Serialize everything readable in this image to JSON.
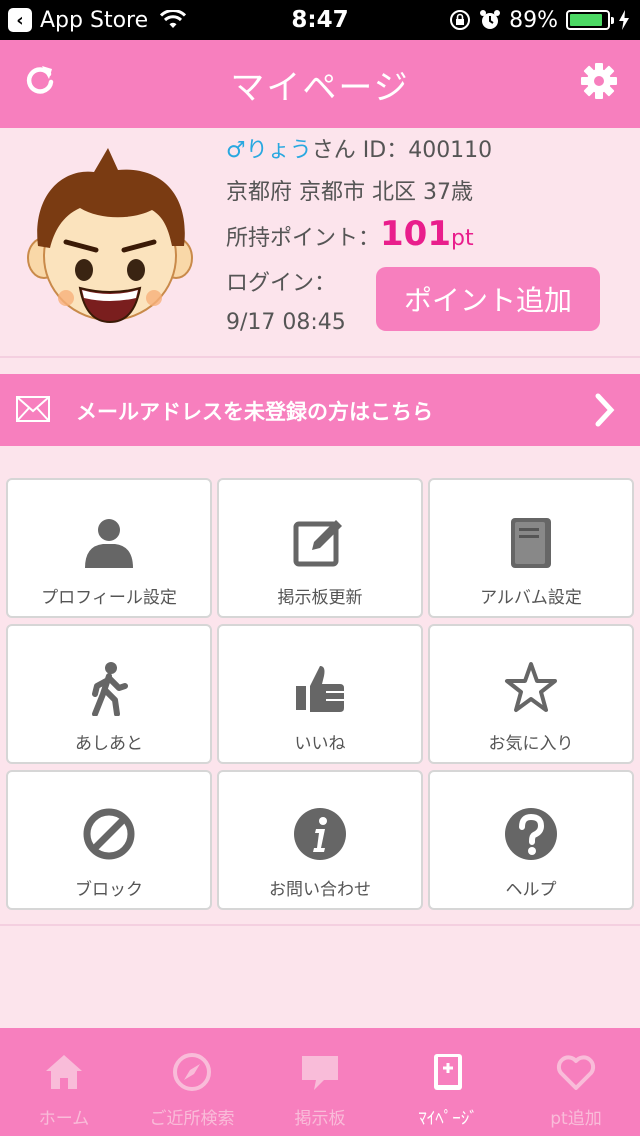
{
  "status_bar": {
    "back_app": "App Store",
    "time": "8:47",
    "battery": "89%",
    "battery_level": 0.89
  },
  "header": {
    "title": "マイページ"
  },
  "profile": {
    "gender_symbol": "♂",
    "name": "りょう",
    "name_suffix": "さん",
    "id_label": "ID：400110",
    "location_age": "京都府 京都市 北区 37歳",
    "points_label": "所持ポイント：",
    "points_value": "101",
    "points_unit": "pt",
    "login_label": "ログイン：",
    "login_time": "9/17 08:45",
    "add_point_button": "ポイント追加"
  },
  "mail_banner": {
    "text": "メールアドレスを未登録の方はこちら"
  },
  "menu": {
    "items": [
      {
        "label": "プロフィール設定",
        "icon": "person-icon"
      },
      {
        "label": "掲示板更新",
        "icon": "edit-icon"
      },
      {
        "label": "アルバム設定",
        "icon": "album-icon"
      },
      {
        "label": "あしあと",
        "icon": "walking-icon"
      },
      {
        "label": "いいね",
        "icon": "thumbs-up-icon"
      },
      {
        "label": "お気に入り",
        "icon": "star-icon"
      },
      {
        "label": "ブロック",
        "icon": "block-icon"
      },
      {
        "label": "お問い合わせ",
        "icon": "info-icon"
      },
      {
        "label": "ヘルプ",
        "icon": "help-icon"
      }
    ]
  },
  "tabbar": {
    "items": [
      {
        "label": "ホーム",
        "icon": "home-icon",
        "active": false
      },
      {
        "label": "ご近所検索",
        "icon": "compass-icon",
        "active": false
      },
      {
        "label": "掲示板",
        "icon": "chat-bubble-icon",
        "active": false
      },
      {
        "label": "ﾏｲﾍﾟｰｼﾞ",
        "icon": "mypage-book-icon",
        "active": true
      },
      {
        "label": "pt追加",
        "icon": "heart-icon",
        "active": false
      }
    ]
  },
  "colors": {
    "accent_pink": "#f77fbe",
    "background_pink": "#fce4ec",
    "points_magenta": "#e91e8c",
    "male_blue": "#29a8e0",
    "icon_gray": "#666666"
  }
}
